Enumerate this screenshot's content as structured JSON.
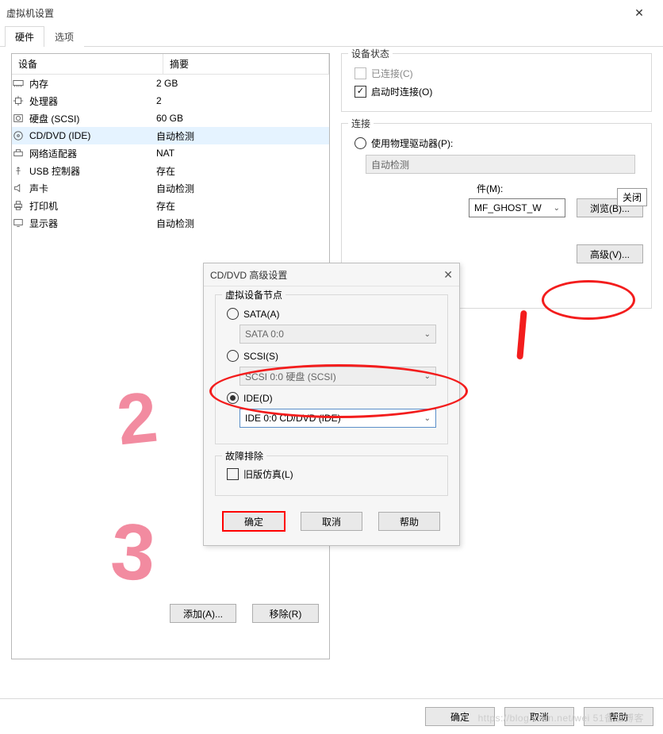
{
  "title": "虚拟机设置",
  "tabs": {
    "hw": "硬件",
    "opt": "选项"
  },
  "headers": {
    "device": "设备",
    "summary": "摘要"
  },
  "devices": [
    {
      "name": "内存",
      "summary": "2 GB",
      "icon": "memory"
    },
    {
      "name": "处理器",
      "summary": "2",
      "icon": "cpu"
    },
    {
      "name": "硬盘 (SCSI)",
      "summary": "60 GB",
      "icon": "hdd"
    },
    {
      "name": "CD/DVD (IDE)",
      "summary": "自动检测",
      "icon": "cd",
      "selected": true
    },
    {
      "name": "网络适配器",
      "summary": "NAT",
      "icon": "net"
    },
    {
      "name": "USB 控制器",
      "summary": "存在",
      "icon": "usb"
    },
    {
      "name": "声卡",
      "summary": "自动检测",
      "icon": "sound"
    },
    {
      "name": "打印机",
      "summary": "存在",
      "icon": "printer"
    },
    {
      "name": "显示器",
      "summary": "自动检测",
      "icon": "display"
    }
  ],
  "status_group": "设备状态",
  "status_connected": "已连接(C)",
  "status_onstart": "启动时连接(O)",
  "conn_group": "连接",
  "conn_physical": "使用物理驱动器(P):",
  "conn_physical_combo": "自动检测",
  "conn_iso_label_tail": "件(M):",
  "conn_iso_combo": "MF_GHOST_W",
  "browse_btn": "浏览(B)...",
  "advanced_btn": "高级(V)...",
  "badge_close": "关闭",
  "modal": {
    "title": "CD/DVD 高级设置",
    "group_node": "虚拟设备节点",
    "sata_label": "SATA(A)",
    "sata_combo": "SATA 0:0",
    "scsi_label": "SCSI(S)",
    "scsi_combo": "SCSI 0:0   硬盘 (SCSI)",
    "ide_label": "IDE(D)",
    "ide_combo": "IDE 0:0   CD/DVD (IDE)",
    "group_trouble": "故障排除",
    "legacy": "旧版仿真(L)",
    "ok": "确定",
    "cancel": "取消",
    "help": "帮助"
  },
  "add_btn": "添加(A)...",
  "remove_btn": "移除(R)",
  "footer": {
    "ok": "确定",
    "cancel": "取消",
    "help": "帮助"
  },
  "watermark": "https://blog.csdn.net/wei   51备忘博客"
}
